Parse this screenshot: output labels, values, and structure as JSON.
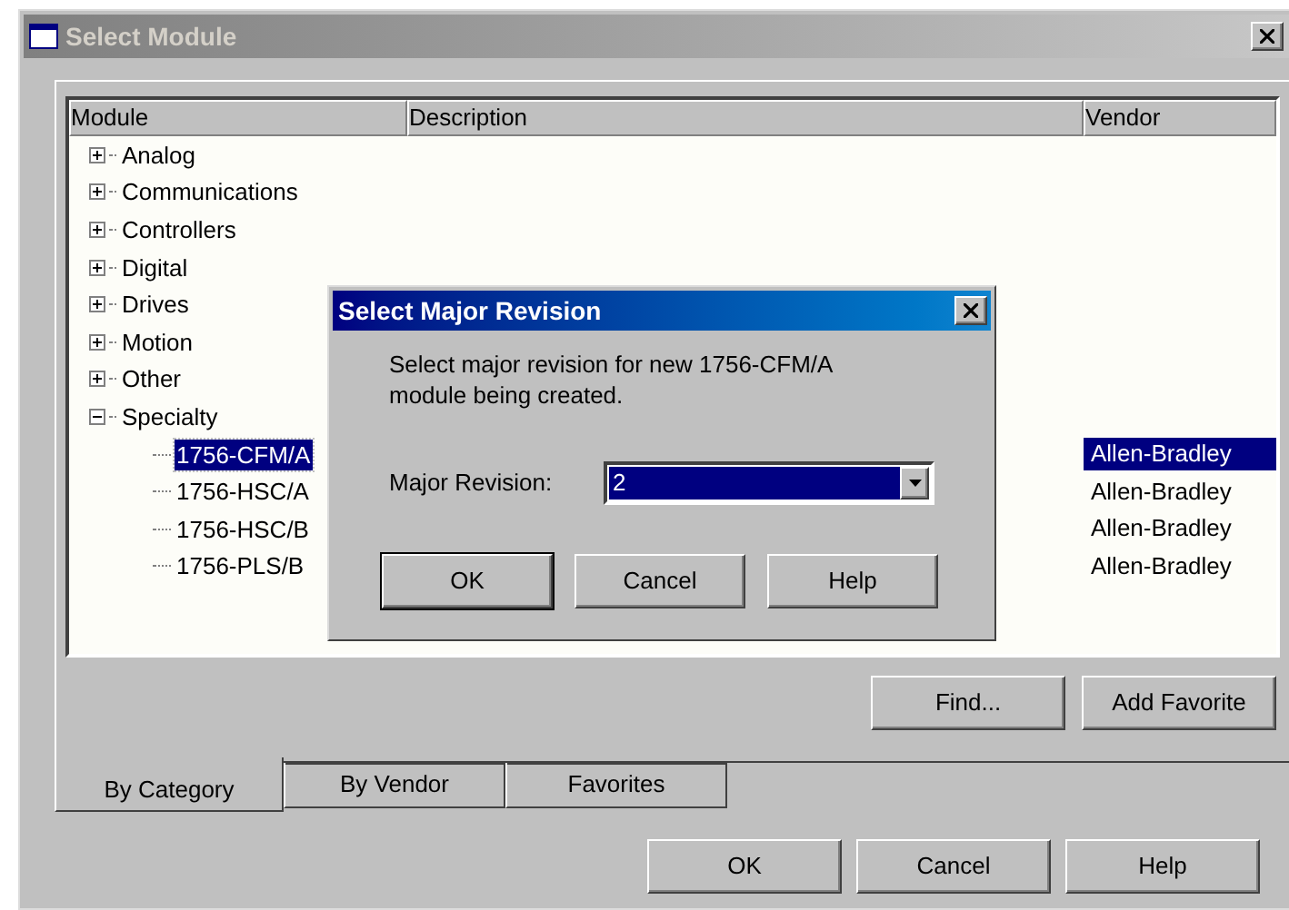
{
  "window": {
    "title": "Select Module"
  },
  "list": {
    "columns": [
      "Module",
      "Description",
      "Vendor"
    ],
    "tree": [
      {
        "label": "Analog",
        "expanded": false
      },
      {
        "label": "Communications",
        "expanded": false
      },
      {
        "label": "Controllers",
        "expanded": false
      },
      {
        "label": "Digital",
        "expanded": false
      },
      {
        "label": "Drives",
        "expanded": false
      },
      {
        "label": "Motion",
        "expanded": false
      },
      {
        "label": "Other",
        "expanded": false
      },
      {
        "label": "Specialty",
        "expanded": true,
        "children": [
          {
            "label": "1756-CFM/A",
            "vendor": "Allen-Bradley",
            "selected": true
          },
          {
            "label": "1756-HSC/A",
            "vendor": "Allen-Bradley",
            "selected": false
          },
          {
            "label": "1756-HSC/B",
            "vendor": "Allen-Bradley",
            "selected": false
          },
          {
            "label": "1756-PLS/B",
            "vendor": "Allen-Bradley",
            "selected": false
          }
        ]
      }
    ]
  },
  "panel_buttons": [
    "Find...",
    "Add Favorite"
  ],
  "tabs": [
    {
      "label": "By Category",
      "selected": true
    },
    {
      "label": "By Vendor",
      "selected": false
    },
    {
      "label": "Favorites",
      "selected": false
    }
  ],
  "buttons": [
    "OK",
    "Cancel",
    "Help"
  ],
  "dialog": {
    "title": "Select Major Revision",
    "message": "Select major revision for new 1756-CFM/A module being created.",
    "field_label": "Major Revision:",
    "value": "2",
    "buttons": [
      "OK",
      "Cancel",
      "Help"
    ]
  }
}
